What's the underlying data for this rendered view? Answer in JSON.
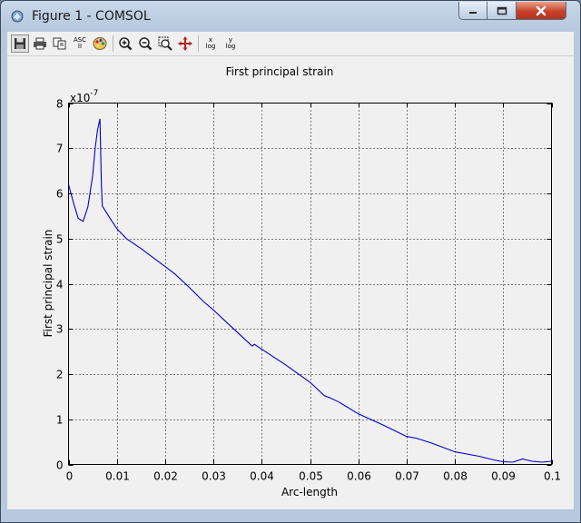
{
  "window": {
    "title": "Figure 1 - COMSOL"
  },
  "toolbar": {
    "buttons": [
      "save-icon",
      "print-icon",
      "copy-icon",
      "export-ascii-icon",
      "color-palette-icon",
      "zoom-in-icon",
      "zoom-out-icon",
      "zoom-extents-icon",
      "pan-icon",
      "x-log-icon",
      "y-log-icon"
    ],
    "ascii_label_top": "ASC",
    "ascii_label_bottom": "II",
    "xlog_top": "x",
    "xlog_bottom": "log",
    "ylog_top": "y",
    "ylog_bottom": "log"
  },
  "colors": {
    "line": "#0000cc",
    "grid": "#000000",
    "title_bar": "#c9d8ea",
    "close_button": "#c8432b"
  },
  "chart_data": {
    "type": "line",
    "title": "First principal strain",
    "xlabel": "Arc-length",
    "ylabel": "First principal strain",
    "y_multiplier": "x10",
    "y_exponent": "-7",
    "xlim": [
      0,
      0.1
    ],
    "ylim": [
      0,
      8
    ],
    "grid": true,
    "x_ticks": [
      0,
      0.01,
      0.02,
      0.03,
      0.04,
      0.05,
      0.06,
      0.07,
      0.08,
      0.09,
      0.1
    ],
    "x_tick_labels": [
      "0",
      "0.01",
      "0.02",
      "0.03",
      "0.04",
      "0.05",
      "0.06",
      "0.07",
      "0.08",
      "0.09",
      "0.1"
    ],
    "y_ticks": [
      0,
      1,
      2,
      3,
      4,
      5,
      6,
      7,
      8
    ],
    "y_tick_labels": [
      "0",
      "1",
      "2",
      "3",
      "4",
      "5",
      "6",
      "7",
      "8"
    ],
    "series": [
      {
        "x": [
          0,
          0.001,
          0.002,
          0.003,
          0.004,
          0.005,
          0.0055,
          0.006,
          0.0065,
          0.0068,
          0.007,
          0.008,
          0.009,
          0.01,
          0.012,
          0.014,
          0.015,
          0.017,
          0.02,
          0.022,
          0.025,
          0.028,
          0.03,
          0.032,
          0.035,
          0.038,
          0.0385,
          0.04,
          0.045,
          0.05,
          0.053,
          0.054,
          0.056,
          0.06,
          0.065,
          0.07,
          0.072,
          0.075,
          0.078,
          0.08,
          0.085,
          0.088,
          0.09,
          0.092,
          0.094,
          0.096,
          0.098,
          0.1
        ],
        "values": [
          6.2,
          5.8,
          5.45,
          5.38,
          5.7,
          6.4,
          7.0,
          7.4,
          7.65,
          6.2,
          5.72,
          5.55,
          5.38,
          5.22,
          5.0,
          4.85,
          4.78,
          4.62,
          4.38,
          4.22,
          3.92,
          3.6,
          3.42,
          3.22,
          2.92,
          2.62,
          2.66,
          2.55,
          2.2,
          1.82,
          1.52,
          1.48,
          1.38,
          1.12,
          0.88,
          0.62,
          0.58,
          0.48,
          0.36,
          0.28,
          0.18,
          0.1,
          0.06,
          0.05,
          0.12,
          0.07,
          0.05,
          0.07
        ]
      }
    ]
  }
}
